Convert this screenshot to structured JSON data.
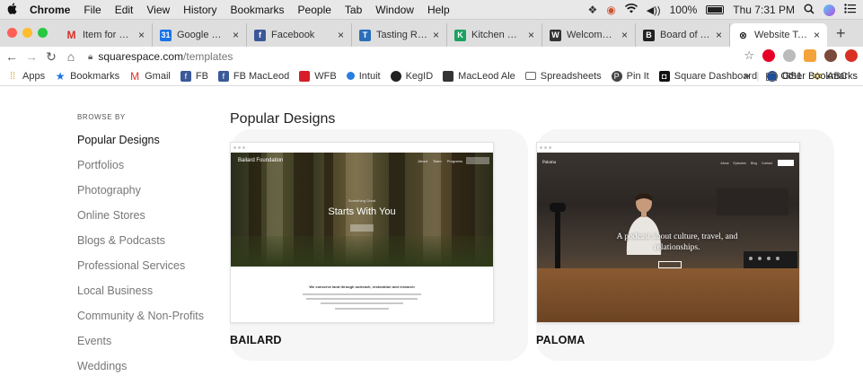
{
  "menubar": {
    "apple": "",
    "app": "Chrome",
    "items": [
      "File",
      "Edit",
      "View",
      "History",
      "Bookmarks",
      "People",
      "Tab",
      "Window",
      "Help"
    ],
    "battery": "100%",
    "clock": "Thu 7:31 PM"
  },
  "tabs": [
    {
      "title": "Item for Board M",
      "favicon": "gmail-icon",
      "color": "#d93025",
      "letter": "M"
    },
    {
      "title": "Google Calendar",
      "favicon": "calendar-icon",
      "color": "#1a73e8",
      "letter": "31"
    },
    {
      "title": "Facebook",
      "favicon": "facebook-icon",
      "color": "#3b5998",
      "letter": "f"
    },
    {
      "title": "Tasting Room & ",
      "favicon": "tasting-icon",
      "color": "#2a6ebb",
      "letter": "T"
    },
    {
      "title": "Kitchen Staff Aw",
      "favicon": "kitchen-icon",
      "color": "#1aa260",
      "letter": "K"
    },
    {
      "title": "Welcome — Mac",
      "favicon": "macleod-icon",
      "color": "#333333",
      "letter": "W"
    },
    {
      "title": "Board of Trustee",
      "favicon": "board-icon",
      "color": "#222222",
      "letter": "B"
    },
    {
      "title": "Website Templat",
      "favicon": "squarespace-icon",
      "color": "#000000",
      "letter": "S"
    }
  ],
  "toolbar": {
    "url_host": "squarespace.com",
    "url_path": "/templates"
  },
  "bookmarks": [
    {
      "label": "Apps",
      "icon": "apps-grid-icon",
      "color": "#e0a020"
    },
    {
      "label": "Bookmarks",
      "icon": "star-icon",
      "color": "#1a73e8"
    },
    {
      "label": "Gmail",
      "icon": "gmail-icon",
      "color": "#d93025"
    },
    {
      "label": "FB",
      "icon": "facebook-icon",
      "color": "#3b5998"
    },
    {
      "label": "FB MacLeod",
      "icon": "facebook-icon",
      "color": "#3b5998"
    },
    {
      "label": "WFB",
      "icon": "wfb-icon",
      "color": "#d71e28"
    },
    {
      "label": "Intuit",
      "icon": "intuit-icon",
      "color": "#2ca01c"
    },
    {
      "label": "KegID",
      "icon": "kegid-icon",
      "color": "#222222"
    },
    {
      "label": "MacLeod Ale",
      "icon": "macleod-icon",
      "color": "#333333"
    },
    {
      "label": "Spreadsheets",
      "icon": "folder-icon",
      "color": "#666666"
    },
    {
      "label": "Pin It",
      "icon": "pinterest-icon",
      "color": "#444444"
    },
    {
      "label": "Square Dashboard",
      "icon": "square-icon",
      "color": "#111111"
    },
    {
      "label": "GS1",
      "icon": "gs1-icon",
      "color": "#1f4e9a"
    },
    {
      "label": "ABC",
      "icon": "abc-icon",
      "color": "#b58b00"
    }
  ],
  "bookmarks_overflow": "»",
  "other_bookmarks": "Other Bookmarks",
  "sidebar": {
    "heading": "BROWSE BY",
    "categories": [
      "Popular Designs",
      "Portfolios",
      "Photography",
      "Online Stores",
      "Blogs & Podcasts",
      "Professional Services",
      "Local Business",
      "Community & Non-Profits",
      "Events",
      "Weddings"
    ]
  },
  "main": {
    "title": "Popular Designs"
  },
  "templates": [
    {
      "name": "BAILARD",
      "preview_brand": "Bailard Foundation",
      "preview_nav": [
        "About",
        "Team",
        "Programs"
      ],
      "preview_small": "Something Great",
      "preview_headline": "Starts With You",
      "preview_body_heading": "We conserve land through outreach, restoration and research"
    },
    {
      "name": "PALOMA",
      "preview_brand": "Paloma",
      "preview_nav": [
        "About",
        "Episodes",
        "Blog",
        "Contact"
      ],
      "preview_headline": "A podcast about culture, travel, and relationships."
    }
  ]
}
